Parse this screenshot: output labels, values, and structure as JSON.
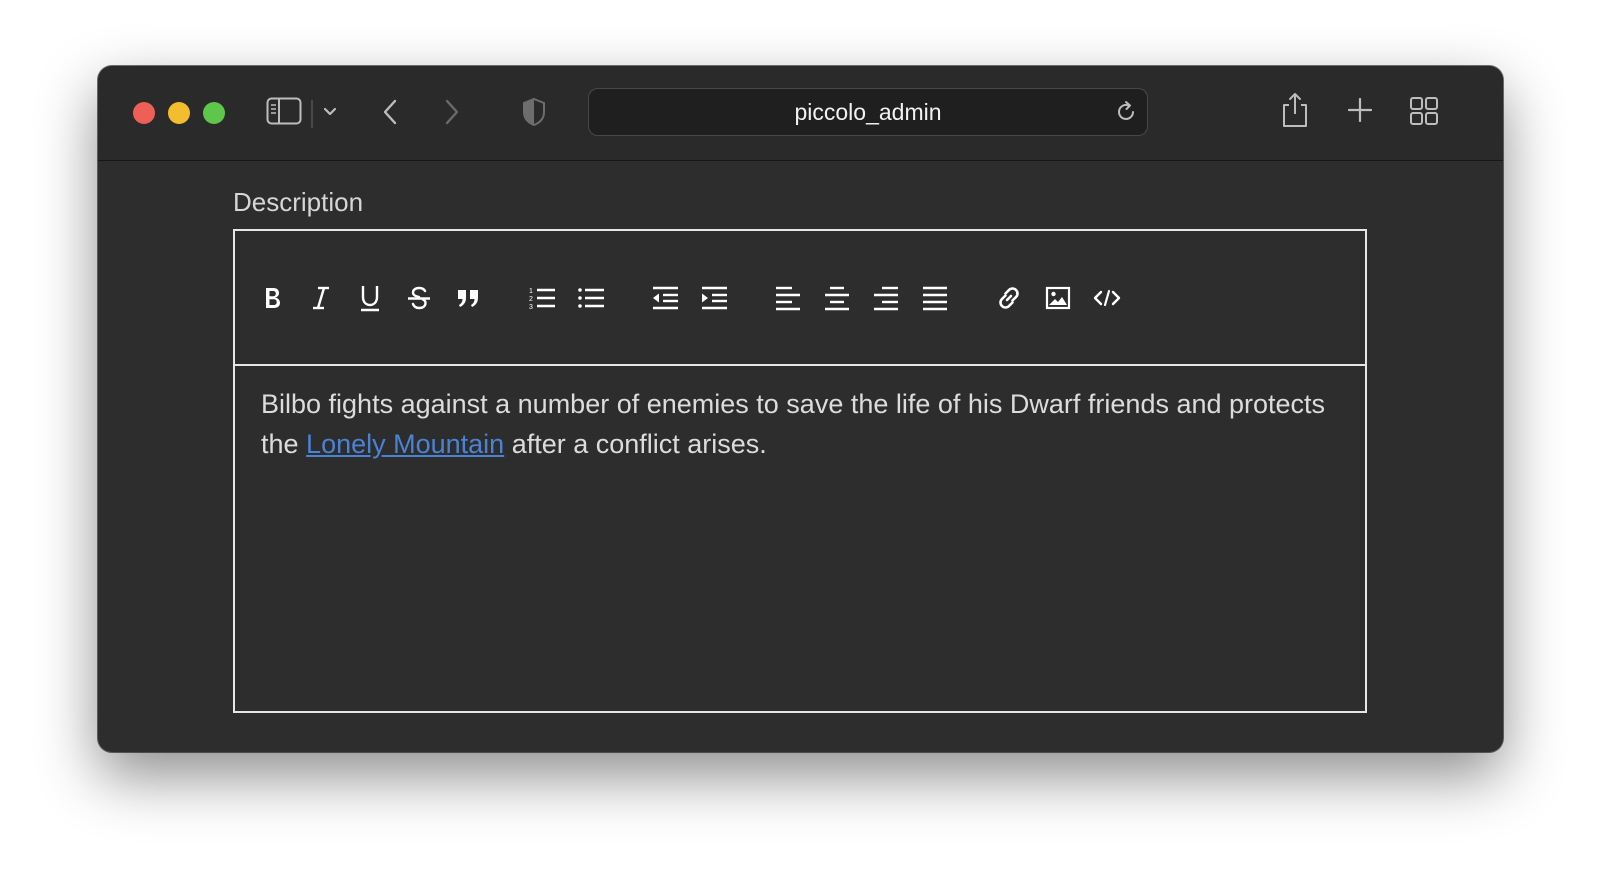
{
  "browser": {
    "address": "piccolo_admin",
    "icons": {
      "sidebar": "sidebar-icon",
      "sidebar_menu": "chevron-down-icon",
      "back": "chevron-left-icon",
      "forward": "chevron-right-icon",
      "privacy": "shield-icon",
      "reload": "reload-icon",
      "share": "share-icon",
      "new_tab": "plus-icon",
      "tab_overview": "grid-icon"
    }
  },
  "form": {
    "label": "Description"
  },
  "toolbar": {
    "buttons": [
      "bold",
      "italic",
      "underline",
      "strikethrough",
      "blockquote",
      "ordered-list",
      "bullet-list",
      "outdent",
      "indent",
      "align-left",
      "align-center",
      "align-right",
      "align-justify",
      "link",
      "image",
      "code"
    ]
  },
  "editor": {
    "text_before": "Bilbo fights against a number of enemies to save the life of his Dwarf friends and protects the ",
    "link_text": "Lonely Mountain",
    "text_after": " after a conflict arises."
  },
  "colors": {
    "window_bg": "#2d2d2e",
    "link": "#4a82d4",
    "close": "#ee5f57",
    "minimize": "#f4bd2f",
    "maximize": "#5fc64c"
  }
}
